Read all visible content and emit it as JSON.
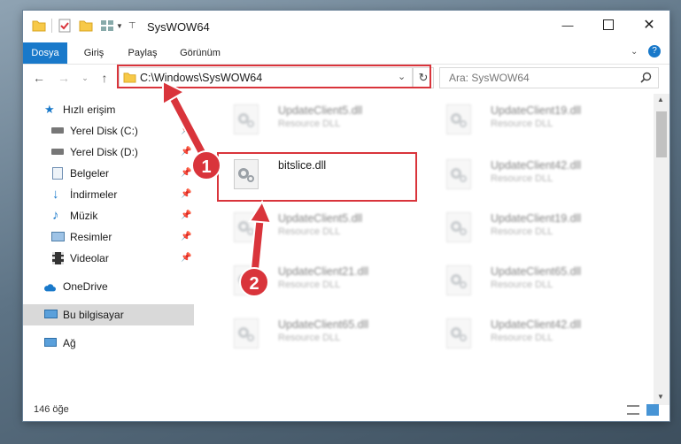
{
  "window": {
    "title": "SysWOW64"
  },
  "ribbon": {
    "tabs": [
      "Dosya",
      "Giriş",
      "Paylaş",
      "Görünüm"
    ]
  },
  "address": {
    "path": "C:\\Windows\\SysWOW64"
  },
  "search": {
    "placeholder": "Ara: SysWOW64"
  },
  "sidebar": {
    "items": [
      {
        "label": "Hızlı erişim",
        "icon": "star-icon"
      },
      {
        "label": "Yerel Disk (C:)",
        "icon": "drive-icon"
      },
      {
        "label": "Yerel Disk (D:)",
        "icon": "drive-icon"
      },
      {
        "label": "Belgeler",
        "icon": "documents-icon"
      },
      {
        "label": "İndirmeler",
        "icon": "download-icon"
      },
      {
        "label": "Müzik",
        "icon": "music-icon"
      },
      {
        "label": "Resimler",
        "icon": "pictures-icon"
      },
      {
        "label": "Videolar",
        "icon": "videos-icon"
      },
      {
        "label": "OneDrive",
        "icon": "cloud-icon"
      },
      {
        "label": "Bu bilgisayar",
        "icon": "computer-icon"
      },
      {
        "label": "Ağ",
        "icon": "network-icon"
      }
    ]
  },
  "files": [
    {
      "name": "UpdateClient5.dll",
      "type": "Resource DLL"
    },
    {
      "name": "UpdateClient19.dll",
      "type": "Resource DLL"
    },
    {
      "name": "bitslice.dll",
      "type": ""
    },
    {
      "name": "UpdateClient42.dll",
      "type": "Resource DLL"
    },
    {
      "name": "UpdateClient5.dll",
      "type": "Resource DLL"
    },
    {
      "name": "UpdateClient19.dll",
      "type": "Resource DLL"
    },
    {
      "name": "UpdateClient21.dll",
      "type": "Resource DLL"
    },
    {
      "name": "UpdateClient65.dll",
      "type": "Resource DLL"
    },
    {
      "name": "UpdateClient65.dll",
      "type": "Resource DLL"
    },
    {
      "name": "UpdateClient42.dll",
      "type": "Resource DLL"
    }
  ],
  "status": {
    "count": "146 öğe"
  },
  "annotations": {
    "badge1": "1",
    "badge2": "2"
  },
  "colors": {
    "accent": "#1979ca",
    "highlight": "#d9343b",
    "folder": "#f7c948"
  }
}
